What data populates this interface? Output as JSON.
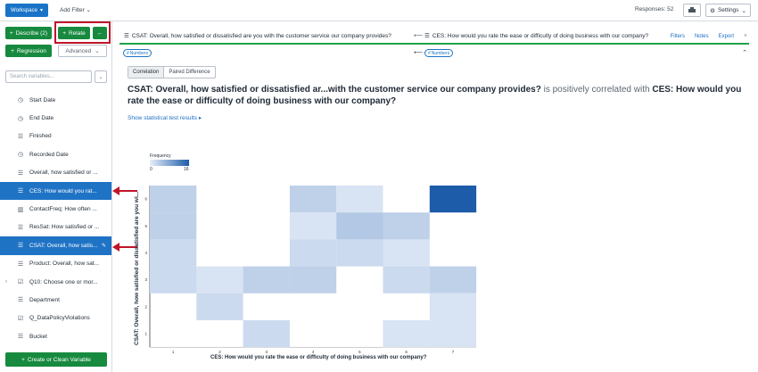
{
  "topbar": {
    "workspace_label": "Workspace",
    "add_filter_label": "Add Filter",
    "responses_label": "Responses: 52",
    "settings_label": "Settings"
  },
  "sidebar": {
    "describe_label": "Describe (2)",
    "relate_label": "Relate",
    "regression_label": "Regression",
    "advanced_label": "Advanced",
    "search_placeholder": "Search variables...",
    "create_label": "Create or Clean Variable",
    "variables": [
      {
        "label": "Start Date",
        "icon": "clock-icon",
        "selected": false
      },
      {
        "label": "End Date",
        "icon": "clock-icon",
        "selected": false
      },
      {
        "label": "Finished",
        "icon": "list-icon",
        "selected": false
      },
      {
        "label": "Recorded Date",
        "icon": "clock-icon",
        "selected": false
      },
      {
        "label": "Overall, how satisfied or ...",
        "icon": "list-icon",
        "selected": false
      },
      {
        "label": "CES: How would you rat...",
        "icon": "list-icon",
        "selected": true
      },
      {
        "label": "ContactFreq: How often ...",
        "icon": "bar-icon",
        "selected": false
      },
      {
        "label": "ResSat: How satisfied or ...",
        "icon": "list-icon",
        "selected": false
      },
      {
        "label": "CSAT: Overall, how satis...",
        "icon": "list-icon",
        "selected": true
      },
      {
        "label": "Product: Overall, how sat...",
        "icon": "list-icon",
        "selected": false
      },
      {
        "label": "Q10: Choose one or mor...",
        "icon": "checkbox-icon",
        "selected": false
      },
      {
        "label": "Department",
        "icon": "list-icon",
        "selected": false
      },
      {
        "label": "Q_DataPolicyViolations",
        "icon": "checkbox-icon",
        "selected": false
      },
      {
        "label": "Bucket",
        "icon": "list-icon",
        "selected": false
      }
    ]
  },
  "main": {
    "left_tab_title": "CSAT: Overall, how satisfied or dissatisfied are you with the customer service our company provides?",
    "right_tab_title": "CES: How would you rate the ease or difficulty of doing business with our company?",
    "links": {
      "filters": "Filters",
      "notes": "Notes",
      "export": "Export"
    },
    "numbers_badge": "Numbers",
    "seg_correlation": "Correlation",
    "seg_paired": "Paired Difference",
    "headline_a": "CSAT: Overall, how satisfied or dissatisfied ar...with the customer service our company provides?",
    "headline_mid": " is positively correlated with ",
    "headline_b": "CES: How would you rate the ease or difficulty of doing business with our company?",
    "stat_link": "Show statistical test results"
  },
  "chart_data": {
    "type": "heatmap",
    "legend_title": "Frequency",
    "legend_min": "0",
    "legend_max": "16",
    "xlabel": "CES: How would you rate the ease or difficulty of doing business with our company?",
    "ylabel": "CSAT: Overall, how satisfied or dissatisfied are you wi...",
    "x_ticks": [
      "1",
      "2",
      "3",
      "4",
      "5",
      "6",
      "7"
    ],
    "y_ticks": [
      "1",
      "2",
      "3",
      "4",
      "5",
      "6"
    ],
    "colors": {
      "low": "#e8effa",
      "high": "#1d5ca8"
    },
    "cells": [
      {
        "x": 1,
        "y": 5,
        "v": 3
      },
      {
        "x": 1,
        "y": 4,
        "v": 3
      },
      {
        "x": 1,
        "y": 3,
        "v": 2
      },
      {
        "x": 1,
        "y": 2,
        "v": 2
      },
      {
        "x": 2,
        "y": 2,
        "v": 1
      },
      {
        "x": 2,
        "y": 1,
        "v": 2
      },
      {
        "x": 3,
        "y": 2,
        "v": 3
      },
      {
        "x": 3,
        "y": 0,
        "v": 2
      },
      {
        "x": 4,
        "y": 5,
        "v": 3
      },
      {
        "x": 4,
        "y": 4,
        "v": 1
      },
      {
        "x": 4,
        "y": 3,
        "v": 2
      },
      {
        "x": 4,
        "y": 2,
        "v": 3
      },
      {
        "x": 5,
        "y": 5,
        "v": 1
      },
      {
        "x": 5,
        "y": 4,
        "v": 4
      },
      {
        "x": 5,
        "y": 3,
        "v": 2
      },
      {
        "x": 6,
        "y": 4,
        "v": 3
      },
      {
        "x": 6,
        "y": 3,
        "v": 1
      },
      {
        "x": 6,
        "y": 2,
        "v": 2
      },
      {
        "x": 6,
        "y": 0,
        "v": 1
      },
      {
        "x": 7,
        "y": 5,
        "v": 16
      },
      {
        "x": 7,
        "y": 2,
        "v": 3
      },
      {
        "x": 7,
        "y": 1,
        "v": 1
      },
      {
        "x": 7,
        "y": 0,
        "v": 1
      }
    ]
  }
}
